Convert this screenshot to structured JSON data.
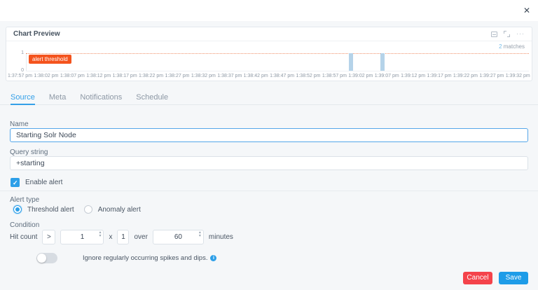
{
  "modal": {
    "close_icon": "✕"
  },
  "chart_panel": {
    "title": "Chart Preview",
    "legend": {
      "count": "2",
      "label": "matches"
    },
    "threshold_badge": "alert threshold",
    "y_ticks": {
      "top": "1",
      "bottom": "0"
    },
    "more_icon": "···"
  },
  "chart_data": {
    "type": "bar",
    "title": "Chart Preview",
    "categories": [
      "1:37:57 pm",
      "1:38:02 pm",
      "1:38:07 pm",
      "1:38:12 pm",
      "1:38:17 pm",
      "1:38:22 pm",
      "1:38:27 pm",
      "1:38:32 pm",
      "1:38:37 pm",
      "1:38:42 pm",
      "1:38:47 pm",
      "1:38:52 pm",
      "1:38:57 pm",
      "1:39:02 pm",
      "1:39:07 pm",
      "1:39:12 pm",
      "1:39:17 pm",
      "1:39:22 pm",
      "1:39:27 pm",
      "1:39:32 pm"
    ],
    "values": [
      0,
      0,
      0,
      0,
      0,
      0,
      0,
      0,
      0,
      0,
      0,
      0,
      0,
      1,
      1,
      0,
      0,
      0,
      0,
      0
    ],
    "bars": [
      {
        "x_pct": 65.6,
        "value": 1
      },
      {
        "x_pct": 71.6,
        "value": 1
      }
    ],
    "threshold": 1,
    "threshold_label": "alert threshold",
    "ylim": [
      0,
      1
    ],
    "legend": "2 matches",
    "legend_position": "top-right",
    "grid": false,
    "bar_color": "#b5d3e9",
    "threshold_color": "#f4531d"
  },
  "tabs": [
    {
      "label": "Source",
      "active": true
    },
    {
      "label": "Meta",
      "active": false
    },
    {
      "label": "Notifications",
      "active": false
    },
    {
      "label": "Schedule",
      "active": false
    }
  ],
  "form": {
    "name": {
      "label": "Name",
      "value": "Starting Solr Node"
    },
    "query": {
      "label": "Query string",
      "value": "+starting"
    },
    "enable_alert": {
      "label": "Enable alert",
      "checked": true
    },
    "alert_type": {
      "label": "Alert type",
      "options": [
        {
          "label": "Threshold alert",
          "selected": true
        },
        {
          "label": "Anomaly alert",
          "selected": false
        }
      ]
    },
    "condition": {
      "label": "Condition",
      "prefix": "Hit count",
      "operator": ">",
      "count_value": "1",
      "times_label": "x",
      "multiplier_value": "1",
      "over_label": "over",
      "window_value": "60",
      "suffix": "minutes"
    },
    "ignore_spikes": {
      "label": "Ignore regularly occurring spikes and dips.",
      "enabled": false,
      "info_icon": "i"
    }
  },
  "footer": {
    "cancel_label": "Cancel",
    "save_label": "Save"
  },
  "colors": {
    "accent": "#2d9fe8",
    "danger": "#f4434b",
    "threshold": "#f4531d",
    "bar": "#b5d3e9"
  }
}
